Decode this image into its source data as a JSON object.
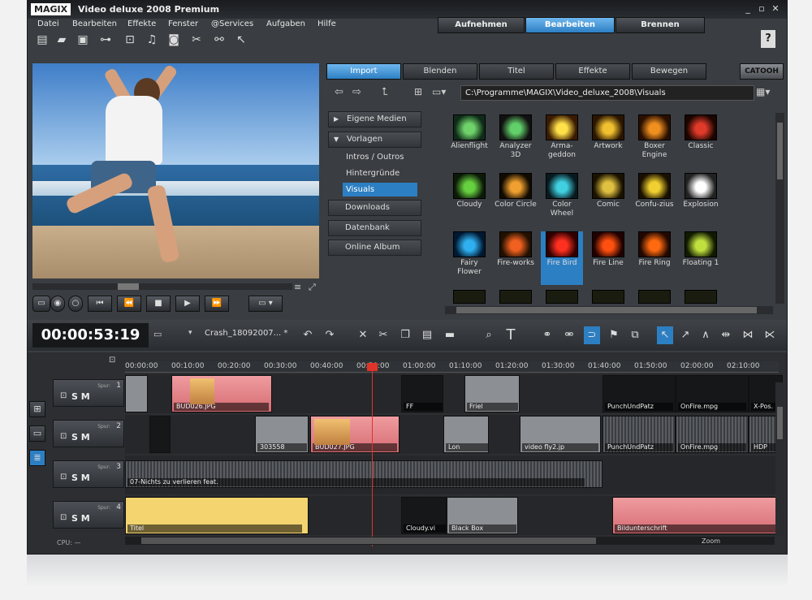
{
  "app": {
    "logo": "MAGIX",
    "title": "Video deluxe 2008 Premium"
  },
  "window_controls": [
    "_",
    "▫",
    "✕"
  ],
  "menu": [
    "Datei",
    "Bearbeiten",
    "Effekte",
    "Fenster",
    "@Services",
    "Aufgaben",
    "Hilfe"
  ],
  "toolbar_icons": [
    "new-file-icon",
    "open-folder-icon",
    "save-icon",
    "capture-icon",
    "import-video-icon",
    "music-icon",
    "dvd-icon",
    "effects-icon",
    "link-icon",
    "pointer-help-icon"
  ],
  "mode_tabs": [
    {
      "label": "Aufnehmen",
      "active": false
    },
    {
      "label": "Bearbeiten",
      "active": true
    },
    {
      "label": "Brennen",
      "active": false
    }
  ],
  "help_label": "?",
  "media_tabs": [
    {
      "label": "Import",
      "active": true
    },
    {
      "label": "Blenden",
      "active": false
    },
    {
      "label": "Titel",
      "active": false
    },
    {
      "label": "Effekte",
      "active": false
    },
    {
      "label": "Bewegen",
      "active": false
    }
  ],
  "catooh_label": "CATOOH",
  "path": "C:\\Programme\\MAGIX\\Video_deluxe_2008\\Visuals",
  "categories": [
    {
      "label": "Eigene Medien"
    },
    {
      "label": "Vorlagen"
    }
  ],
  "subcategories": [
    {
      "label": "Intros / Outros",
      "active": false
    },
    {
      "label": "Hintergründe",
      "active": false
    },
    {
      "label": "Visuals",
      "active": true
    }
  ],
  "extra_categories": [
    "Downloads",
    "Datenbank",
    "Online Album"
  ],
  "visuals": [
    "Alienflight",
    "Analyzer 3D",
    "Arma-geddon",
    "Artwork",
    "Boxer Engine",
    "Classic",
    "Cloudy",
    "Color Circle",
    "Color Wheel",
    "Comic",
    "Confu-zius",
    "Explosion",
    "Fairy Flower",
    "Fire-works",
    "Fire Bird",
    "Fire Line",
    "Fire Ring",
    "Floating 1"
  ],
  "selected_visual": "Fire Bird",
  "timecode": "00:00:53:19",
  "project_name": "Crash_18092007... *",
  "ruler": [
    "00:00:00",
    "00:10:00",
    "00:20:00",
    "00:30:00",
    "00:40:00",
    "00:50:00",
    "01:00:00",
    "01:10:00",
    "01:20:00",
    "01:30:00",
    "01:40:00",
    "01:50:00",
    "02:00:00",
    "02:10:00"
  ],
  "tracks": [
    {
      "num": "1",
      "spur": "Spur:",
      "controls": "S M"
    },
    {
      "num": "2",
      "spur": "Spur:",
      "controls": "S M"
    },
    {
      "num": "3",
      "spur": "Spur:",
      "controls": "S M"
    },
    {
      "num": "4",
      "spur": "Spur:",
      "controls": "S M"
    }
  ],
  "clips": {
    "t1": [
      "BUD026.JPG",
      "FF",
      "Friel",
      "PunchUndPatz",
      "OnFire.mpg",
      "X-Pos."
    ],
    "t2": [
      "303558",
      "BUD027.JPG",
      "Lon",
      "video fly2.jp",
      "PunchUndPatz",
      "OnFire.mpg",
      "HDP"
    ],
    "t3": [
      "07-Nichts zu verlieren feat."
    ],
    "t4": [
      "Titel",
      "Cloudy.vi",
      "Black Box",
      "Bildunterschrift"
    ]
  },
  "cpu_label": "CPU: —",
  "zoom_label": "Zoom",
  "colors": {
    "accent": "#2d7fc3",
    "clip_red": "#e5878c",
    "title_yellow": "#f3d46f",
    "playhead": "#e0342a"
  }
}
